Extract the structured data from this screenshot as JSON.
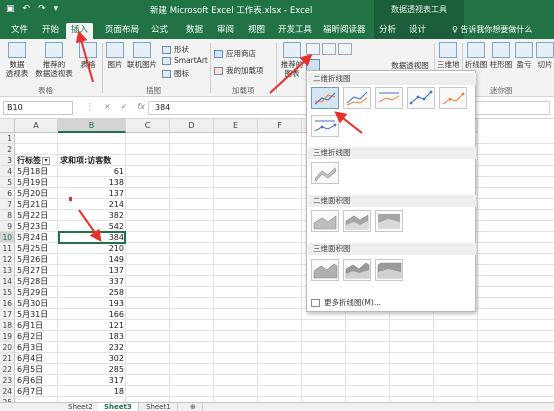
{
  "titlebar": {
    "qat": [
      "▣",
      "↶",
      "↷",
      "▾"
    ],
    "title": "新建 Microsoft Excel 工作表.xlsx - Excel",
    "contextual_title": "数据透视表工具"
  },
  "tabs": [
    "文件",
    "开始",
    "插入",
    "页面布局",
    "公式",
    "数据",
    "审阅",
    "视图",
    "开发工具",
    "福昕阅读器",
    "分析",
    "设计"
  ],
  "tell_me": "♀ 告诉我你想要做什么",
  "ribbon": {
    "pivot_table": "数据\n透视表",
    "recommended_pivot": "推荐的\n数据透视表",
    "table": "表格",
    "picture": "图片",
    "online_picture": "联机图片",
    "shapes": "形状",
    "smartart": "SmartArt",
    "icons": "图标",
    "store": "应用商店",
    "my_addins": "我的加载项",
    "recommended_charts": "推荐的\n图表",
    "pivot_chart": "数据透视图",
    "map_3d": "三维地\n图",
    "sparkline_line": "折线图",
    "sparkline_column": "柱形图",
    "sparkline_winloss": "盈亏",
    "slicer": "切片",
    "group_tables": "表格",
    "group_illustrations": "插图",
    "group_addins": "加载项",
    "group_sparklines": "迷你图"
  },
  "formula_bar": {
    "name_box": "B10",
    "icons": [
      "⋮",
      "×",
      "✓",
      "fx"
    ],
    "value": "384"
  },
  "columns": [
    "A",
    "B",
    "C",
    "D",
    "E",
    "F",
    "G",
    "H",
    "I",
    "J"
  ],
  "rows": [
    "1",
    "2",
    "3",
    "4",
    "5",
    "6",
    "7",
    "8",
    "9",
    "10",
    "11",
    "12",
    "13",
    "14",
    "15",
    "16",
    "17",
    "18",
    "19",
    "20",
    "21",
    "22",
    "23",
    "24",
    "25"
  ],
  "table": {
    "header_a": "行标签",
    "header_b": "求和项:访客数",
    "data": [
      [
        "5月18日",
        "61"
      ],
      [
        "5月19日",
        "138"
      ],
      [
        "5月20日",
        "137"
      ],
      [
        "5月21日",
        "214"
      ],
      [
        "5月22日",
        "382"
      ],
      [
        "5月23日",
        "542"
      ],
      [
        "5月24日",
        "384"
      ],
      [
        "5月25日",
        "210"
      ],
      [
        "5月26日",
        "149"
      ],
      [
        "5月27日",
        "137"
      ],
      [
        "5月28日",
        "337"
      ],
      [
        "5月29日",
        "258"
      ],
      [
        "5月30日",
        "193"
      ],
      [
        "5月31日",
        "166"
      ],
      [
        "6月1日",
        "121"
      ],
      [
        "6月2日",
        "183"
      ],
      [
        "6月3日",
        "232"
      ],
      [
        "6月4日",
        "302"
      ],
      [
        "6月5日",
        "285"
      ],
      [
        "6月6日",
        "317"
      ],
      [
        "6月7日",
        "18"
      ]
    ]
  },
  "selected_cell": "B10",
  "sheets": [
    "Sheet2",
    "Sheet3",
    "Sheet1",
    "⊕"
  ],
  "dropdown": {
    "section_2d_line": "二维折线图",
    "section_3d_line": "三维折线图",
    "section_2d_area": "二维面积图",
    "section_3d_area": "三维面积图",
    "more": "更多折线图(M)..."
  },
  "colors": {
    "excel_green": "#217346",
    "arrow_red": "#e8302a"
  }
}
